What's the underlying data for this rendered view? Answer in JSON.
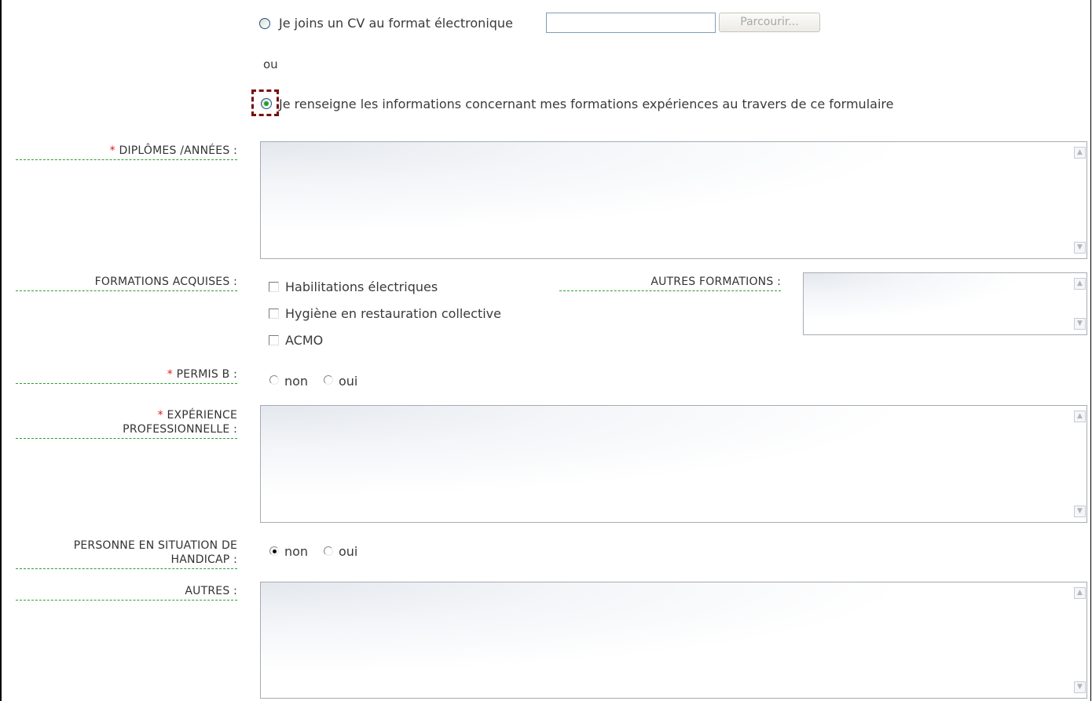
{
  "cv": {
    "upload_label": "Je joins un CV au format électronique",
    "file_value": "",
    "browse_label": "Parcourir...",
    "or_label": "ou",
    "form_label": "Je renseigne les informations concernant  mes formations expériences au travers de ce formulaire"
  },
  "required_marker": "*",
  "diplomes": {
    "label": "DIPLÔMES /ANNÉES :",
    "value": ""
  },
  "formations": {
    "label": "FORMATIONS ACQUISES :",
    "options": [
      "Habilitations électriques",
      "Hygiène en restauration collective",
      "ACMO"
    ],
    "autres_label": "AUTRES FORMATIONS :",
    "autres_value": ""
  },
  "permis": {
    "label": "PERMIS B :",
    "no": "non",
    "yes": "oui"
  },
  "experience": {
    "label_line1": "EXPÉRIENCE",
    "label_line2": "PROFESSIONNELLE :",
    "value": ""
  },
  "handicap": {
    "label_line1": "PERSONNE EN SITUATION DE",
    "label_line2": "HANDICAP :",
    "no": "non",
    "yes": "oui"
  },
  "autres": {
    "label": "AUTRES :",
    "value": ""
  },
  "scroll_icons": {
    "up": "chevron-up-icon",
    "down": "chevron-down-icon"
  },
  "colors": {
    "required": "#e01818",
    "underline": "#2c9e2c",
    "focus": "#7a0d0d",
    "selected_radio": "#21a121"
  }
}
